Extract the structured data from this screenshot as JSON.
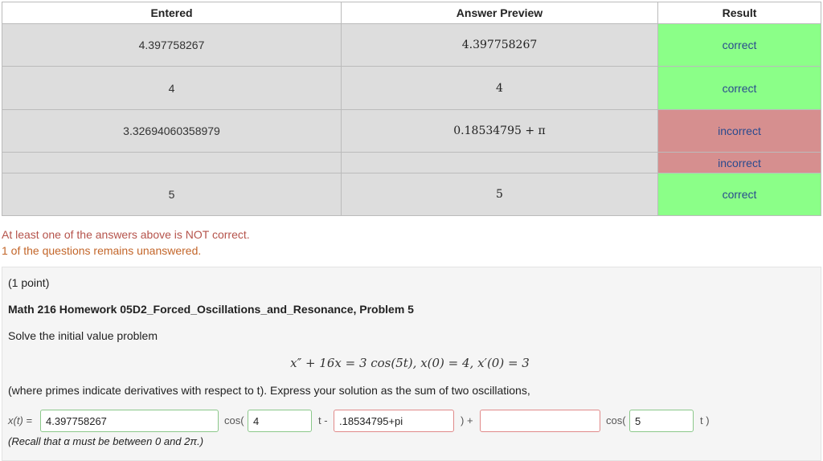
{
  "table": {
    "headers": [
      "Entered",
      "Answer Preview",
      "Result"
    ],
    "rows": [
      {
        "entered": "4.397758267",
        "preview": "4.397758267",
        "result": "correct"
      },
      {
        "entered": "4",
        "preview": "4",
        "result": "correct"
      },
      {
        "entered": "3.32694060358979",
        "preview": "0.18534795 + π",
        "result": "incorrect"
      },
      {
        "entered": "",
        "preview": "",
        "result": "incorrect"
      },
      {
        "entered": "5",
        "preview": "5",
        "result": "correct"
      }
    ]
  },
  "messages": {
    "not_correct": "At least one of the answers above is NOT correct.",
    "unanswered": "1 of the questions remains unanswered."
  },
  "problem": {
    "points": "(1 point)",
    "title": "Math 216 Homework 05D2_Forced_Oscillations_and_Resonance, Problem 5",
    "prompt": "Solve the initial value problem",
    "equation": "x″ + 16x = 3 cos(5t), x(0) = 4, x′(0) = 3",
    "instructions": "(where primes indicate derivatives with respect to t). Express your solution as the sum of two oscillations,",
    "xt_label": "x(t) =",
    "cos1": "cos(",
    "t_minus": "t -",
    "paren_plus": ") +",
    "cos2": "cos(",
    "t_close": "t )",
    "inputs": [
      "4.397758267",
      "4",
      ".18534795+pi",
      "",
      "5"
    ],
    "recall": "(Recall that α must be between 0 and 2π.)"
  },
  "colors": {
    "correct": "#8bff88",
    "incorrect": "#d68f8f"
  }
}
